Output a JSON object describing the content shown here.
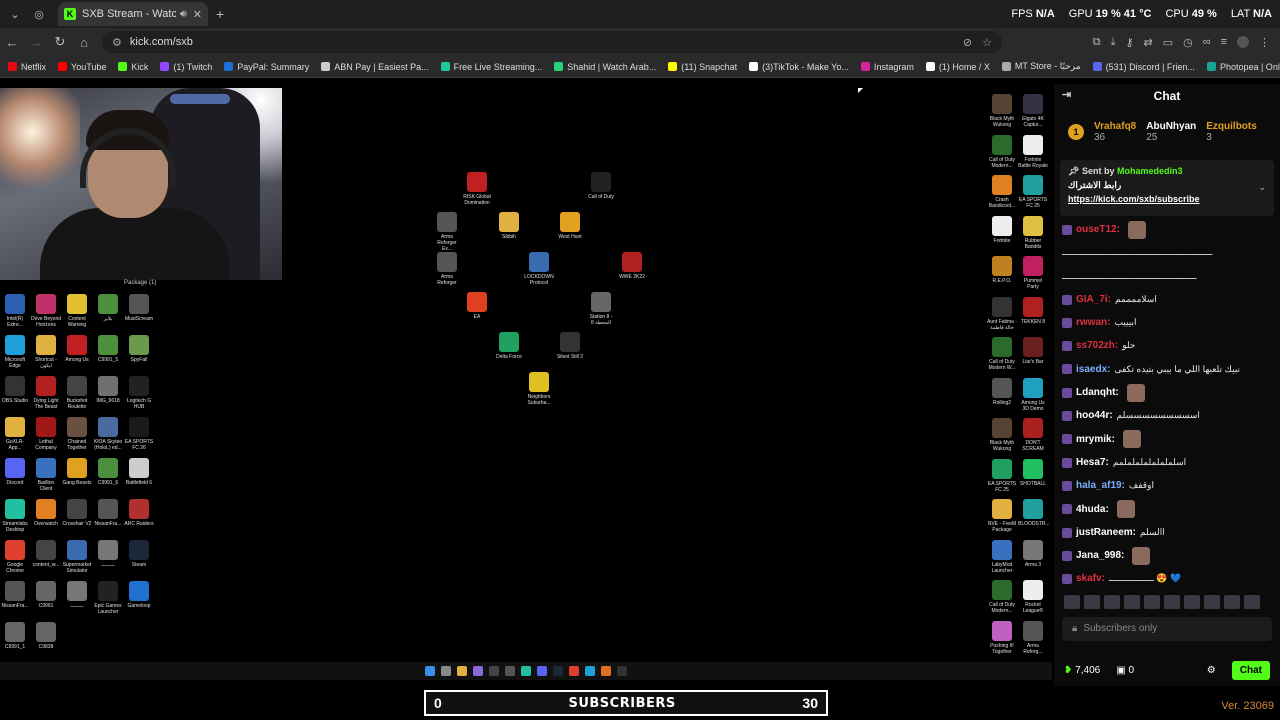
{
  "browser": {
    "tab_title": "SXB Stream - Watch Live on",
    "url": "kick.com/sxb",
    "stats": {
      "fps_label": "FPS",
      "fps": "N/A",
      "gpu_label": "GPU",
      "gpu": "19 % 41 °C",
      "cpu_label": "CPU",
      "cpu": "49 %",
      "lat_label": "LAT",
      "lat": "N/A"
    },
    "bookmarks": [
      {
        "label": "Netflix",
        "color": "#e50914"
      },
      {
        "label": "YouTube",
        "color": "#ff0000"
      },
      {
        "label": "Kick",
        "color": "#53fc18"
      },
      {
        "label": "(1) Twitch",
        "color": "#9146ff"
      },
      {
        "label": "PayPal: Summary",
        "color": "#1f6fd6"
      },
      {
        "label": "ABN Pay | Easiest Pa...",
        "color": "#cccccc"
      },
      {
        "label": "Free Live Streaming...",
        "color": "#1ec9a0"
      },
      {
        "label": "Shahid | Watch Arab...",
        "color": "#26d07c"
      },
      {
        "label": "(11) Snapchat",
        "color": "#fffc00"
      },
      {
        "label": "(3)TikTok - Make Yo...",
        "color": "#ffffff"
      },
      {
        "label": "Instagram",
        "color": "#d6249f"
      },
      {
        "label": "(1) Home / X",
        "color": "#ffffff"
      },
      {
        "label": "MT Store - مرحبًا",
        "color": "#aaaaaa"
      },
      {
        "label": "(531) Discord | Frien...",
        "color": "#5865f2"
      },
      {
        "label": "Photopea | Online P...",
        "color": "#18a497"
      }
    ]
  },
  "stream": {
    "package_label": "Package (1)",
    "left_icons": [
      {
        "label": "Intel(R) Extre...",
        "color": "#2b5fb0"
      },
      {
        "label": "Drive Beyond Horizons",
        "color": "#c0306a"
      },
      {
        "label": "Content Warning",
        "color": "#e0c030"
      },
      {
        "label": "بلاير",
        "color": "#4c8f3c"
      },
      {
        "label": "MustScream",
        "color": "#555555"
      },
      {
        "label": "Microsoft Edge",
        "color": "#1ea0d8"
      },
      {
        "label": "Shortcut - ايكون",
        "color": "#e0b040"
      },
      {
        "label": "Among Us",
        "color": "#c02020"
      },
      {
        "label": "C9991_5",
        "color": "#4c8f3c"
      },
      {
        "label": "SpyFall",
        "color": "#6a9a4a"
      },
      {
        "label": "OBS Studio",
        "color": "#333333"
      },
      {
        "label": "Dying Light The Beast",
        "color": "#b02020"
      },
      {
        "label": "Buckshot Roulette",
        "color": "#444444"
      },
      {
        "label": "IMG_9618",
        "color": "#707070"
      },
      {
        "label": "Logitech G HUB",
        "color": "#222222"
      },
      {
        "label": "GoXLR-App...",
        "color": "#e0b040"
      },
      {
        "label": "Lethal Company",
        "color": "#a01818"
      },
      {
        "label": "Chained Together",
        "color": "#6a5040"
      },
      {
        "label": "KIOA Skyteo (HoloL) ed...",
        "color": "#4a6aa0"
      },
      {
        "label": "EA SPORTS FC 26",
        "color": "#1a1a1a"
      },
      {
        "label": "Discord",
        "color": "#5865f2"
      },
      {
        "label": "Badlion Client",
        "color": "#3a70c0"
      },
      {
        "label": "Gang Beasts",
        "color": "#e0a020"
      },
      {
        "label": "C9991_6",
        "color": "#4c8f3c"
      },
      {
        "label": "Battlefield 6",
        "color": "#cccccc"
      },
      {
        "label": "Streamlabs Desktop",
        "color": "#20c0a0"
      },
      {
        "label": "Overwatch",
        "color": "#e08020"
      },
      {
        "label": "Crosshair V2",
        "color": "#444444"
      },
      {
        "label": "NissanFra...",
        "color": "#555555"
      },
      {
        "label": "ARC Raiders",
        "color": "#b03030"
      },
      {
        "label": "Google Chrome",
        "color": "#e04030"
      },
      {
        "label": "content_w...",
        "color": "#444444"
      },
      {
        "label": "Supermarket Simulator",
        "color": "#3a6ab0"
      },
      {
        "label": "ـــــــــ",
        "color": "#777777"
      },
      {
        "label": "Steam",
        "color": "#1b2838"
      },
      {
        "label": "NissanFra...",
        "color": "#555555"
      },
      {
        "label": "C9991",
        "color": "#666666"
      },
      {
        "label": "ـــــــــ",
        "color": "#777777"
      },
      {
        "label": "Epic Games Launcher",
        "color": "#222222"
      },
      {
        "label": "Gameloop",
        "color": "#2070d0"
      },
      {
        "label": "C9991_1",
        "color": "#666666"
      },
      {
        "label": "C9838",
        "color": "#666666"
      }
    ],
    "center_icons": [
      {
        "label": "RISK Global Domination",
        "color": "#c02020"
      },
      {
        "label": "Call of Duty",
        "color": "#222222"
      },
      {
        "label": "Arma Reforger Ex...",
        "color": "#555555"
      },
      {
        "label": "Sibbih",
        "color": "#e0b040"
      },
      {
        "label": "West Hunt",
        "color": "#e0a020"
      },
      {
        "label": "Arma Reforger",
        "color": "#555555"
      },
      {
        "label": "LOCKDOWN Protocol",
        "color": "#3a6ab0"
      },
      {
        "label": "WWE 2K22",
        "color": "#b02020"
      },
      {
        "label": "EA",
        "color": "#e04020"
      },
      {
        "label": "Station 8 - المحطة 8",
        "color": "#666666"
      },
      {
        "label": "Delta Force",
        "color": "#20a060"
      },
      {
        "label": "Silent Still 2",
        "color": "#333333"
      },
      {
        "label": "Neighbors Suburba...",
        "color": "#e0c020"
      }
    ],
    "right_icons": [
      {
        "label": "Black Myth Wukong",
        "color": "#554433"
      },
      {
        "label": "Elgato 4K Captur...",
        "color": "#333344"
      },
      {
        "label": "Call of Duty Modern...",
        "color": "#2a6a2a"
      },
      {
        "label": "Fortnite Battle Royale",
        "color": "#eeeeee"
      },
      {
        "label": "Crash Bandicoot...",
        "color": "#e08020"
      },
      {
        "label": "EA SPORTS FC 25",
        "color": "#20a0a0"
      },
      {
        "label": "Fortnite",
        "color": "#eeeeee"
      },
      {
        "label": "Rubber Bandits",
        "color": "#e0c040"
      },
      {
        "label": "R.E.P.O.",
        "color": "#c08020"
      },
      {
        "label": "Pummel Party",
        "color": "#c02060"
      },
      {
        "label": "Aunt Fatima - خالة فاطمة",
        "color": "#333333"
      },
      {
        "label": "TEKKEN 8",
        "color": "#b02020"
      },
      {
        "label": "Call of Duty Modern W...",
        "color": "#2a6a2a"
      },
      {
        "label": "Liar's Bar",
        "color": "#6a2020"
      },
      {
        "label": "Rolling2",
        "color": "#555555"
      },
      {
        "label": "Among Us 3D Demo",
        "color": "#20a0c0"
      },
      {
        "label": "Black Myth Wukong",
        "color": "#554433"
      },
      {
        "label": "DON'T SCREAM",
        "color": "#aa2020"
      },
      {
        "label": "EA SPORTS FC 25",
        "color": "#20a060"
      },
      {
        "label": "SHOTBALL",
        "color": "#20c060"
      },
      {
        "label": "NVE - FiveM Package",
        "color": "#e0b040"
      },
      {
        "label": "BLOODSTR...",
        "color": "#20a0a0"
      },
      {
        "label": "LabyMod Launcher",
        "color": "#3a70c0"
      },
      {
        "label": "Arma 3",
        "color": "#777777"
      },
      {
        "label": "Call of Duty Modern...",
        "color": "#2a6a2a"
      },
      {
        "label": "Rocket League®",
        "color": "#eeeeee"
      },
      {
        "label": "Pushing It! Together",
        "color": "#c060c0"
      },
      {
        "label": "Arma Reforg...",
        "color": "#555555"
      }
    ],
    "cursor_visible": true
  },
  "chat": {
    "title": "Chat",
    "leaders": [
      {
        "name": "Vrahafq8",
        "count": "36",
        "color": "#e0a020"
      },
      {
        "name": "AbuNhyan",
        "count": "25",
        "color": "#ffffff"
      },
      {
        "name": "Ezquilbots",
        "count": "3",
        "color": "#e0a020"
      }
    ],
    "pinned": {
      "sent_by": "Sent by",
      "sender": "Mohamededin3",
      "text": "رابط الاشتراك",
      "link": "https://kick.com/sxb/subscribe"
    },
    "messages": [
      {
        "user": "ouseT12:",
        "color": "#e03040",
        "text": ""
      },
      {
        "user": "",
        "color": "#ffffff",
        "text": "ـــــــــــــــــــــــــــــــــــــــــــــــــــــــــ"
      },
      {
        "user": "",
        "color": "#ffffff",
        "text": "ـــــــــــــــــــــــــــــــــــــــــــــــــــ"
      },
      {
        "user": "GIA_7i:",
        "color": "#e03040",
        "text": "اسلاممممم"
      },
      {
        "user": "rwwan:",
        "color": "#e03040",
        "text": "ابيييب"
      },
      {
        "user": "ss702zh:",
        "color": "#e03040",
        "text": "حلو"
      },
      {
        "user": "isaedx:",
        "color": "#7ab0ff",
        "text": "نبيك تلعبها اللي ما بيبي بتيده تكفى"
      },
      {
        "user": "Ldanqht:",
        "color": "#ffffff",
        "text": ""
      },
      {
        "user": "hoo44r:",
        "color": "#ffffff",
        "text": "اسسسسسسسسسلم"
      },
      {
        "user": "mrymik:",
        "color": "#ffffff",
        "text": ""
      },
      {
        "user": "Hesa7:",
        "color": "#ffffff",
        "text": "اسلململململململمم"
      },
      {
        "user": "hala_af19:",
        "color": "#7ab0ff",
        "text": "اوقفف"
      },
      {
        "user": "4huda:",
        "color": "#ffffff",
        "text": ""
      },
      {
        "user": "justRaneem:",
        "color": "#ffffff",
        "text": "االسلم"
      },
      {
        "user": "Jana_998:",
        "color": "#ffffff",
        "text": ""
      },
      {
        "user": "skafv:",
        "color": "#e03040",
        "text": "ـــــــــــــــــ 😍 💙"
      }
    ],
    "input_placeholder": "Subscribers only",
    "viewers": "7,406",
    "gift_count": "0",
    "chat_button": "Chat"
  },
  "subscribers_bar": {
    "left": "0",
    "label": "SUBSCRIBERS",
    "right": "30"
  },
  "version": "Ver. 23069"
}
